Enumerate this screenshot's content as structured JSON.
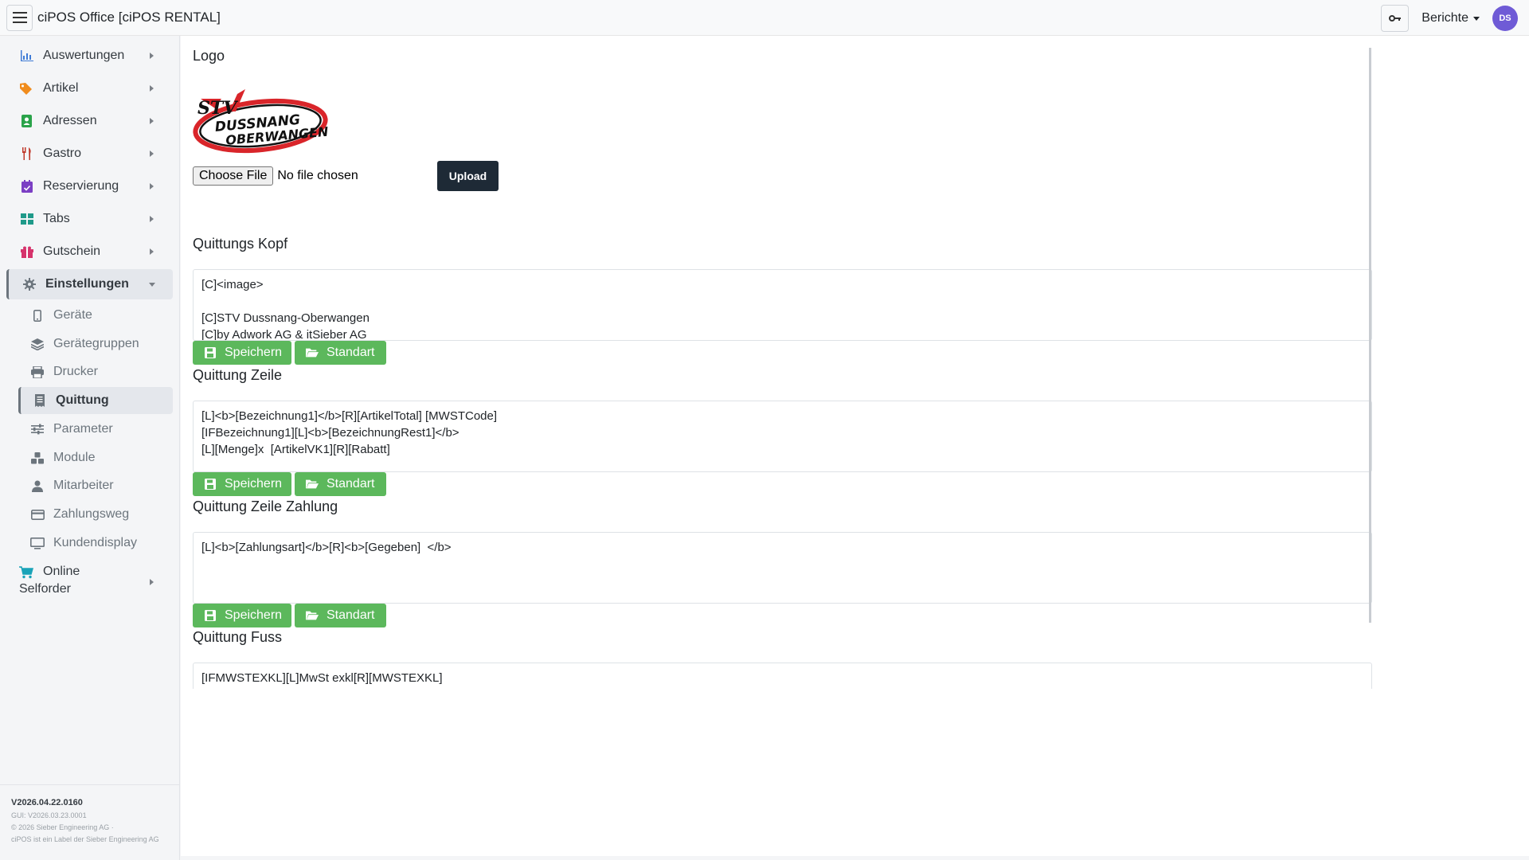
{
  "app": {
    "title": "ciPOS Office [ciPOS RENTAL]"
  },
  "header": {
    "reports_label": "Berichte",
    "avatar_initials": "DS"
  },
  "sidebar": {
    "items": [
      {
        "label": "Auswertungen",
        "icon": "bar-chart-icon",
        "color": "#3f7bd6"
      },
      {
        "label": "Artikel",
        "icon": "tags-icon",
        "color": "#f08c1d"
      },
      {
        "label": "Adressen",
        "icon": "address-book-icon",
        "color": "#2aa34a"
      },
      {
        "label": "Gastro",
        "icon": "utensils-icon",
        "color": "#c0392b"
      },
      {
        "label": "Reservierung",
        "icon": "calendar-check-icon",
        "color": "#7b3fc4"
      },
      {
        "label": "Tabs",
        "icon": "grid-icon",
        "color": "#1f9a8a"
      },
      {
        "label": "Gutschein",
        "icon": "gift-icon",
        "color": "#d6336c"
      },
      {
        "label": "Einstellungen",
        "icon": "gear-icon",
        "color": "#6c757d"
      }
    ],
    "subitems": [
      {
        "label": "Geräte",
        "icon": "mobile-icon"
      },
      {
        "label": "Gerätegruppen",
        "icon": "layers-icon"
      },
      {
        "label": "Drucker",
        "icon": "printer-icon"
      },
      {
        "label": "Quittung",
        "icon": "receipt-icon"
      },
      {
        "label": "Parameter",
        "icon": "sliders-icon"
      },
      {
        "label": "Module",
        "icon": "cubes-icon"
      },
      {
        "label": "Mitarbeiter",
        "icon": "user-icon"
      },
      {
        "label": "Zahlungsweg",
        "icon": "credit-card-icon"
      },
      {
        "label": "Kundendisplay",
        "icon": "monitor-icon"
      }
    ],
    "online": {
      "line1": "Online",
      "line2": "Selforder",
      "icon": "cart-icon",
      "color": "#1aa3b8"
    },
    "footer": {
      "version": "V2026.04.22.0160",
      "gui": "GUI: V2026.03.23.0001",
      "copyright": "© 2026 Sieber Engineering AG ·",
      "label": "ciPOS ist ein Label der Sieber Engineering AG"
    }
  },
  "main": {
    "logo": {
      "title": "Logo",
      "choose_label": "Choose File",
      "no_file_label": "No file chosen",
      "upload_label": "Upload",
      "logo_text_top": "STV",
      "logo_text_mid": "DUSSNANG",
      "logo_text_bot": "OBERWANGEN"
    },
    "sections": [
      {
        "title": "Quittungs Kopf",
        "text": "[C]<image>\n\n[C]STV Dussnang-Oberwangen\n[C]by Adwork AG & itSieber AG"
      },
      {
        "title": "Quittung Zeile",
        "text": "[L]<b>[Bezeichnung1]</b>[R][ArtikelTotal] [MWSTCode]\n[IFBezeichnung1][L]<b>[BezeichnungRest1]</b>\n[L][Menge]x  [ArtikelVK1][R][Rabatt]"
      },
      {
        "title": "Quittung Zeile Zahlung",
        "text": "[L]<b>[Zahlungsart]</b>[R]<b>[Gegeben]  </b>"
      },
      {
        "title": "Quittung Fuss",
        "text": "[IFMWSTEXKL][L]MwSt exkl[R][MWSTEXKL]"
      }
    ],
    "save_label": "Speichern",
    "default_label": "Standart"
  },
  "colors": {
    "accent_green": "#5cb85c",
    "upload_dark": "#1e2a36",
    "avatar": "#6f5bd6"
  }
}
